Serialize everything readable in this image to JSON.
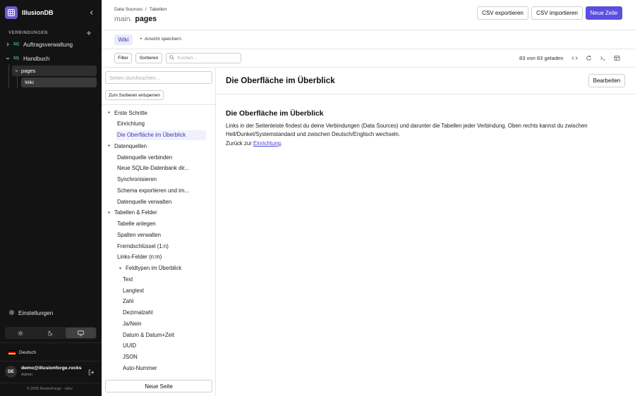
{
  "app": {
    "name": "IllusionDB"
  },
  "sidebar": {
    "section_label": "VERBINDUNGEN",
    "connections": [
      {
        "badge": "SQ",
        "label": "Auftragsverwaltung",
        "expanded": false
      },
      {
        "badge": "SQ",
        "label": "Handbuch",
        "expanded": true
      }
    ],
    "table": {
      "label": "pages"
    },
    "view": {
      "label": "Wiki"
    },
    "settings_label": "Einstellungen",
    "theme_active": "system",
    "language": "Deutsch",
    "user": {
      "initials": "DE",
      "email": "demo@illusionforge.rocks",
      "role": "Admin"
    },
    "footer": "© 2026 IllusionForge · vdev"
  },
  "header": {
    "breadcrumb": [
      "Data Sources",
      "/",
      "Tabellen"
    ],
    "schema": "main.",
    "table_name": "pages",
    "buttons": {
      "export": "CSV exportieren",
      "import": "CSV importieren",
      "new_row": "Neue Zeile"
    }
  },
  "views": {
    "tab": "Wiki",
    "save_view": "Ansicht speichern"
  },
  "toolbar": {
    "filter": "Filter",
    "sort": "Sortieren",
    "search_placeholder": "Suchen...",
    "loaded": "83 von 83 geladen"
  },
  "pages_panel": {
    "search_placeholder": "Seiten durchsuchen...",
    "reset_sort": "Zum Sortieren entsperren",
    "new_page": "Neue Seite",
    "tree": [
      {
        "label": "Erste Schritte",
        "depth": 0,
        "group": true
      },
      {
        "label": "Einrichtung",
        "depth": 1
      },
      {
        "label": "Die Oberfläche im Überblick",
        "depth": 1,
        "active": true
      },
      {
        "label": "Datenquellen",
        "depth": 0,
        "group": true
      },
      {
        "label": "Datenquelle verbinden",
        "depth": 1
      },
      {
        "label": "Neue SQLite-Datenbank dir...",
        "depth": 1
      },
      {
        "label": "Synchronisieren",
        "depth": 1
      },
      {
        "label": "Schema exportieren und im...",
        "depth": 1
      },
      {
        "label": "Datenquelle verwalten",
        "depth": 1
      },
      {
        "label": "Tabellen & Felder",
        "depth": 0,
        "group": true
      },
      {
        "label": "Tabelle anlegen",
        "depth": 1
      },
      {
        "label": "Spalten verwalten",
        "depth": 1
      },
      {
        "label": "Fremdschlüssel (1:n)",
        "depth": 1
      },
      {
        "label": "Links-Felder (n:m)",
        "depth": 1
      },
      {
        "label": "Feldtypen im Überblick",
        "depth": 1,
        "group": true
      },
      {
        "label": "Text",
        "depth": 2
      },
      {
        "label": "Langtext",
        "depth": 2
      },
      {
        "label": "Zahl",
        "depth": 2
      },
      {
        "label": "Dezimalzahl",
        "depth": 2
      },
      {
        "label": "Ja/Nein",
        "depth": 2
      },
      {
        "label": "Datum & Datum+Zeit",
        "depth": 2
      },
      {
        "label": "UUID",
        "depth": 2
      },
      {
        "label": "JSON",
        "depth": 2
      },
      {
        "label": "Auto-Nummer",
        "depth": 2
      }
    ]
  },
  "document": {
    "title": "Die Oberfläche im Überblick",
    "edit_label": "Bearbeiten",
    "heading": "Die Oberfläche im Überblick",
    "body": "Links in der Seitenleiste findest du deine Verbindungen (Data Sources) und darunter die Tabellen jeder Verbindung. Oben rechts kannst du zwischen Hell/Dunkel/Systemstandard und zwischen Deutsch/Englisch wechseln.",
    "back_prefix": "Zurück zur",
    "back_link": "Einrichtung",
    "back_suffix": "."
  },
  "colors": {
    "accent": "#5b4fe0",
    "sidebar_bg": "#131313",
    "badge": "#4cc36a"
  }
}
